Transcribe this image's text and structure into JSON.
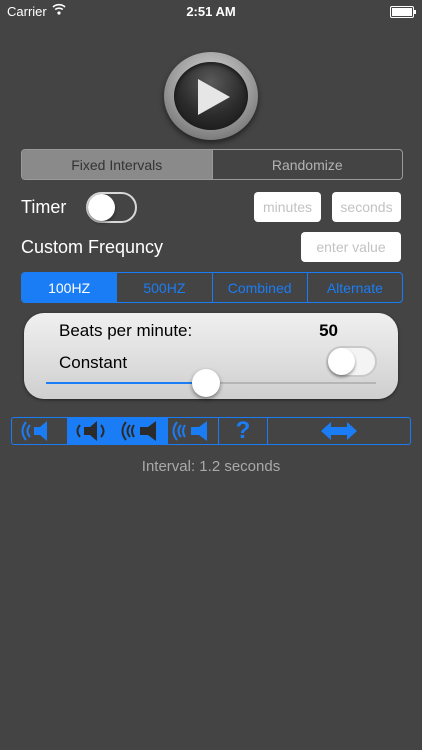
{
  "status_bar": {
    "carrier": "Carrier",
    "time": "2:51 AM"
  },
  "mode_segment": {
    "items": [
      "Fixed Intervals",
      "Randomize"
    ],
    "selected": 0
  },
  "timer": {
    "label": "Timer",
    "enabled": false,
    "minutes_placeholder": "minutes",
    "seconds_placeholder": "seconds"
  },
  "custom_frequency": {
    "label": "Custom Frequncy",
    "placeholder": "enter value"
  },
  "frequency_segment": {
    "items": [
      "100HZ",
      "500HZ",
      "Combined",
      "Alternate"
    ],
    "selected": 0
  },
  "beats_panel": {
    "beats_label": "Beats per minute:",
    "beats_value": "50",
    "constant_label": "Constant",
    "constant_enabled": false,
    "slider_fraction": 0.45
  },
  "toolbar": {
    "icons": [
      "speaker-left-icon",
      "speaker-both-icon",
      "sound-waves-right-icon",
      "sound-waves-left-icon",
      "help-icon",
      "swap-arrows-icon"
    ],
    "selected": 1,
    "help_glyph": "?"
  },
  "interval_text": "Interval: 1.2 seconds",
  "colors": {
    "accent": "#1a7df5",
    "background": "#444444"
  }
}
